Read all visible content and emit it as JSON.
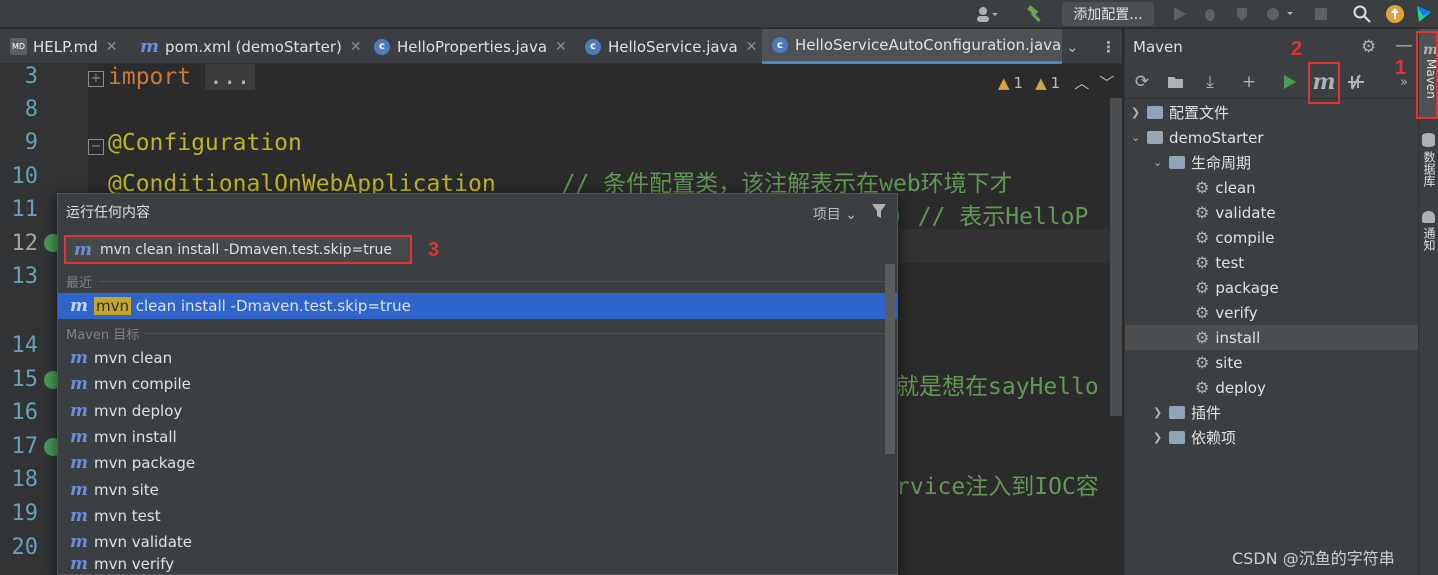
{
  "toolbar": {
    "run_config_label": "添加配置..."
  },
  "tabs": [
    {
      "label": "HELP.md",
      "icon": "md-file-icon"
    },
    {
      "label": "pom.xml (demoStarter)",
      "icon": "maven-m-icon"
    },
    {
      "label": "HelloProperties.java",
      "icon": "class-icon"
    },
    {
      "label": "HelloService.java",
      "icon": "class-icon"
    },
    {
      "label": "HelloServiceAutoConfiguration.java",
      "icon": "class-icon"
    }
  ],
  "editor": {
    "line_numbers": [
      "3",
      "8",
      "9",
      "10",
      "11",
      "12",
      "13",
      "14",
      "15",
      "16",
      "17",
      "18",
      "19",
      "20"
    ],
    "line3_keyword": "import",
    "line3_fold": "...",
    "line9": "@Configuration",
    "line10_annotation": "@ConditionalOnWebApplication",
    "line10_comment": "// 条件配置类，该注解表示在web环境下才",
    "line11_comment": ") // 表示HelloP",
    "line15_comment": "就是想在sayHello",
    "line18_comment": "rvice注入到IOC容",
    "warnings_count": "1",
    "weak_warnings_count": "1"
  },
  "popup": {
    "title": "运行任何内容",
    "scope": "项目",
    "input_value": "mvn clean install -Dmaven.test.skip=true",
    "recent_label": "最近",
    "recent_items": [
      {
        "highlight": "mvn",
        "rest": " clean install -Dmaven.test.skip=true"
      }
    ],
    "goals_label": "Maven 目标",
    "goals": [
      "mvn clean",
      "mvn compile",
      "mvn deploy",
      "mvn install",
      "mvn package",
      "mvn site",
      "mvn test",
      "mvn validate",
      "mvn verify"
    ]
  },
  "maven": {
    "title": "Maven",
    "tree": {
      "profiles": "配置文件",
      "project": "demoStarter",
      "lifecycle": "生命周期",
      "phases": [
        "clean",
        "validate",
        "compile",
        "test",
        "package",
        "verify",
        "install",
        "site",
        "deploy"
      ],
      "plugins": "插件",
      "dependencies": "依赖项"
    },
    "selected_phase": "install"
  },
  "side_strip": {
    "maven": "Maven",
    "database": "数据库",
    "notifications": "通知"
  },
  "annotations": [
    "1",
    "2",
    "3"
  ],
  "watermark": "CSDN @沉鱼的字符串",
  "colors": {
    "accent_blue": "#2f65ca",
    "annotation_red": "#e03333",
    "keyword": "#cc7832",
    "annotation": "#bbb529",
    "comment": "#629755"
  }
}
